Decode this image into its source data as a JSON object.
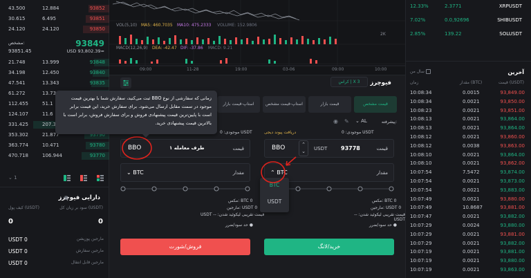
{
  "orderbook": {
    "asks": [
      {
        "amount": "43.500",
        "total": "12.884",
        "price": "93852"
      },
      {
        "amount": "30.615",
        "total": "6.495",
        "price": "93851"
      },
      {
        "amount": "24.120",
        "total": "24.120",
        "price": "93850"
      }
    ],
    "spread_label": "مشخص:",
    "spread_value": "93851.45",
    "last_price": "93849",
    "last_price_usd": "USD 93,802.39≈",
    "bids": [
      {
        "amount": "21.748",
        "total": "13.999",
        "price": "93848"
      },
      {
        "amount": "34.198",
        "total": "12.450",
        "price": "93840"
      },
      {
        "amount": "47.541",
        "total": "13.343",
        "price": "93835"
      },
      {
        "amount": "61.272",
        "total": "13.73",
        "price": "93831"
      },
      {
        "amount": "112.455",
        "total": "51.1",
        "price": "93820"
      },
      {
        "amount": "124.107",
        "total": "11.6",
        "price": "93812"
      },
      {
        "amount": "331.425",
        "total": "207.3",
        "price": "93800"
      },
      {
        "amount": "353.302",
        "total": "21.877",
        "price": "93790"
      },
      {
        "amount": "363.774",
        "total": "10.471",
        "price": "93780"
      },
      {
        "amount": "470.718",
        "total": "106.944",
        "price": "93770"
      }
    ],
    "precision": "1"
  },
  "assets": {
    "title": "دارایی فیوچرز",
    "col_left": "کیف پول (USDT)",
    "col_right": "سود بر زیان کل (USDT)",
    "left_value": "0",
    "right_value": "0",
    "rows": [
      {
        "value": "USDT 0",
        "label": "مارجین پوزیشن"
      },
      {
        "value": "USDT 0",
        "label": "مارجین سفارش"
      },
      {
        "value": "USDT 0",
        "label": "مارجین قابل انتقال"
      }
    ]
  },
  "chart": {
    "vol_label": "VOL(5,10)",
    "ma5": "MA5: 460.7035",
    "ma10": "MA10: 475.2333",
    "volume": "VOLUME: 152.9806",
    "volume_axis": "2K",
    "macd_label": "MACD(12,26,9)",
    "dea": "DEA: -42.47",
    "dif": "DIF: -37.86",
    "macd_value": "MACD: 9.21",
    "times": [
      "09:00",
      "11-28",
      "19:00",
      "03-06",
      "09:00",
      "10:00"
    ]
  },
  "form": {
    "title": "فیوچرز",
    "mode_tag": "کراس | X 3",
    "tabs": [
      "قیمت مشخص",
      "قیمت بازار",
      "استاپ-قیمت مشخص",
      "استاپ-قیمت بازار"
    ],
    "advanced": "پیشرفته:",
    "advanced_value": "AL",
    "buy_available": "موجودی: 0 USDT",
    "buy_link": "دریافت پیوند دیجی",
    "sell_available": "موجودی: 0 USDT",
    "price_label": "قیمت",
    "price_value": "93778",
    "price_unit": "USDT",
    "bbo": "BBO",
    "counterparty": "طرف معامله ۱",
    "amount_label": "مقدار",
    "unit": "BTC",
    "dropdown_options": [
      "BTC",
      "USDT"
    ],
    "buy_max": "مکس: BTC 0",
    "buy_margin": "مارجین: USDT 0",
    "buy_liq": "قیمت تقریبی لیکوئید شدن: -- USDT",
    "sell_max": "مکس: BTC 0",
    "sell_margin": "مارجین: USDT 0",
    "sell_liq": "قیمت تقریبی لیکوئید شدن: -- USDT",
    "tp_sl": "حد سود/ضرر",
    "buy_button": "خرید/لانگ",
    "sell_button": "فروش/شورت"
  },
  "tooltip": {
    "text": "زمانی که سفارشی از نوع BBO ثبت می‌کنید، سفارش شما با بهترین قیمت موجود در سمت مقابل ارسال می‌شود. برای سفارش خرید، این قیمت برابر است با پایین‌ترین قیمت پیشنهادی فروش و برای سفارش فروش، برابر است با بالاترین قیمت پیشنهادی خرید."
  },
  "markets": [
    {
      "change": "12.33%",
      "price": "2.3771",
      "symbol": "XRPUSDT"
    },
    {
      "change": "7.02%",
      "price": "0.0,92696",
      "symbol": "SHIBUSDT"
    },
    {
      "change": "2.85%",
      "price": "139.22",
      "symbol": "SOLUSDT"
    }
  ],
  "trades": {
    "title": "آخرین",
    "toggle_label": "سال من",
    "col_price": "قیمت (USDT)",
    "col_amount": "مقدار (BTC)",
    "col_time": "زمان",
    "rows": [
      {
        "time": "10:08:34",
        "amount": "0.0015",
        "price": "93,849.00",
        "side": "sell"
      },
      {
        "time": "10:08:34",
        "amount": "0.0021",
        "price": "93,850.00",
        "side": "sell"
      },
      {
        "time": "10:08:23",
        "amount": "0.0021",
        "price": "93,851.00",
        "side": "sell"
      },
      {
        "time": "10:08:13",
        "amount": "0.0021",
        "price": "93,864.00",
        "side": "buy"
      },
      {
        "time": "10:08:13",
        "amount": "0.0021",
        "price": "93,864.00",
        "side": "buy"
      },
      {
        "time": "10:08:12",
        "amount": "0.0021",
        "price": "93,860.00",
        "side": "sell"
      },
      {
        "time": "10:08:12",
        "amount": "0.0038",
        "price": "93,863.00",
        "side": "sell"
      },
      {
        "time": "10:08:10",
        "amount": "0.0021",
        "price": "93,864.00",
        "side": "buy"
      },
      {
        "time": "10:08:10",
        "amount": "0.0021",
        "price": "93,862.00",
        "side": "sell"
      },
      {
        "time": "10:07:54",
        "amount": "7.5472",
        "price": "93,874.00",
        "side": "buy"
      },
      {
        "time": "10:07:54",
        "amount": "0.0021",
        "price": "93,873.00",
        "side": "buy"
      },
      {
        "time": "10:07:54",
        "amount": "0.0021",
        "price": "93,883.00",
        "side": "buy"
      },
      {
        "time": "10:07:49",
        "amount": "0.0021",
        "price": "93,880.00",
        "side": "sell"
      },
      {
        "time": "10:07:49",
        "amount": "10.8687",
        "price": "93,881.00",
        "side": "sell"
      },
      {
        "time": "10:07:47",
        "amount": "0.0021",
        "price": "93,882.00",
        "side": "buy"
      },
      {
        "time": "10:07:29",
        "amount": "0.0024",
        "price": "93,880.00",
        "side": "buy"
      },
      {
        "time": "10:07:29",
        "amount": "0.0021",
        "price": "93,881.00",
        "side": "sell"
      },
      {
        "time": "10:07:29",
        "amount": "0.0021",
        "price": "93,882.00",
        "side": "buy"
      },
      {
        "time": "10:07:19",
        "amount": "0.0021",
        "price": "93,881.00",
        "side": "buy"
      },
      {
        "time": "10:07:19",
        "amount": "0.0021",
        "price": "93,880.00",
        "side": "buy"
      },
      {
        "time": "10:07:19",
        "amount": "0.0021",
        "price": "93,863.00",
        "side": "buy"
      }
    ]
  }
}
